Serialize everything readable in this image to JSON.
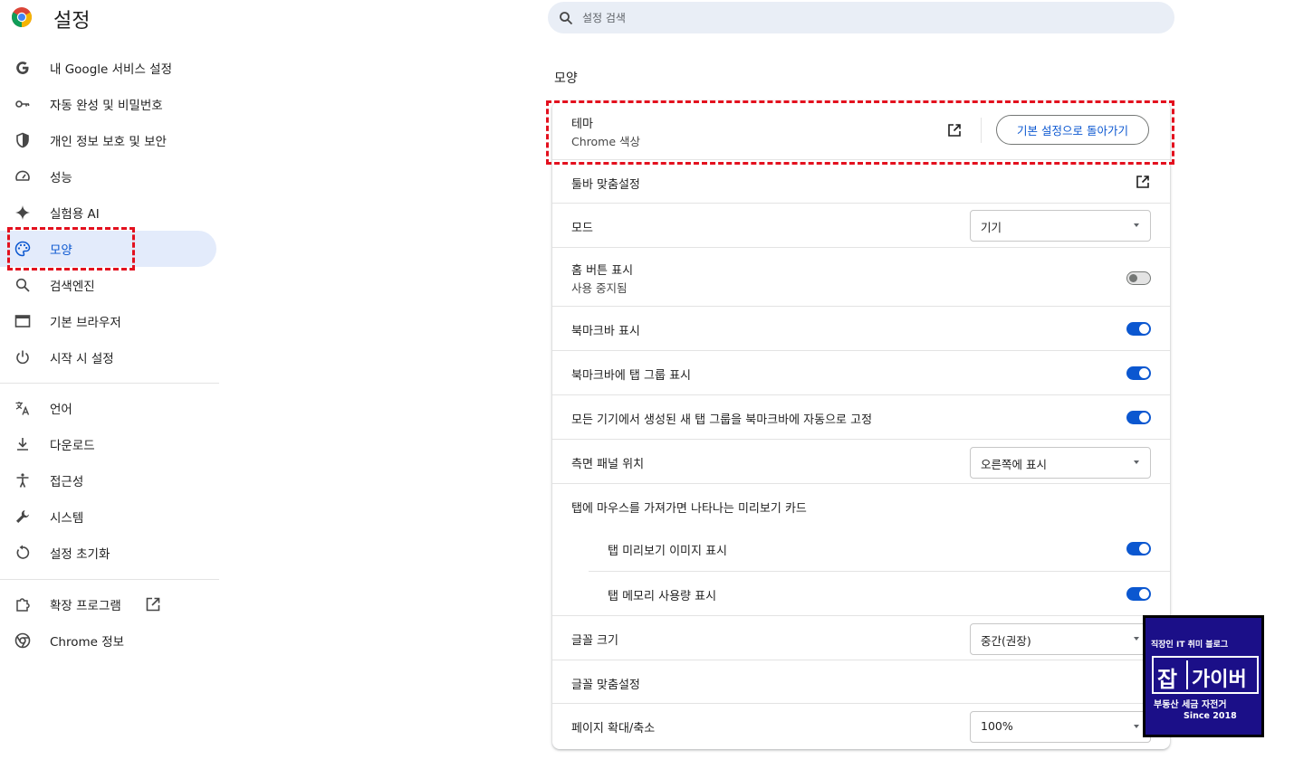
{
  "app": {
    "title": "설정"
  },
  "search": {
    "placeholder": "설정 검색"
  },
  "sidebar": {
    "items": [
      {
        "label": "내 Google 서비스 설정",
        "icon": "google-g-icon"
      },
      {
        "label": "자동 완성 및 비밀번호",
        "icon": "key-icon"
      },
      {
        "label": "개인 정보 보호 및 보안",
        "icon": "shield-icon"
      },
      {
        "label": "성능",
        "icon": "speedometer-icon"
      },
      {
        "label": "실험용 AI",
        "icon": "sparkle-icon"
      },
      {
        "label": "모양",
        "icon": "palette-icon",
        "active": true
      },
      {
        "label": "검색엔진",
        "icon": "search-icon"
      },
      {
        "label": "기본 브라우저",
        "icon": "browser-window-icon"
      },
      {
        "label": "시작 시 설정",
        "icon": "power-icon"
      },
      {
        "label": "언어",
        "icon": "translate-icon"
      },
      {
        "label": "다운로드",
        "icon": "download-icon"
      },
      {
        "label": "접근성",
        "icon": "accessibility-icon"
      },
      {
        "label": "시스템",
        "icon": "wrench-icon"
      },
      {
        "label": "설정 초기화",
        "icon": "reset-icon"
      },
      {
        "label": "확장 프로그램",
        "icon": "puzzle-icon"
      },
      {
        "label": "Chrome 정보",
        "icon": "chrome-icon"
      }
    ]
  },
  "main": {
    "section_title": "모양",
    "theme": {
      "title": "테마",
      "subtitle": "Chrome 색상",
      "reset_label": "기본 설정으로 돌아가기"
    },
    "toolbar": {
      "title": "툴바 맞춤설정"
    },
    "mode": {
      "title": "모드",
      "value": "기기"
    },
    "home_button": {
      "title": "홈 버튼 표시",
      "subtitle": "사용 중지됨",
      "enabled": false
    },
    "bookmarks_bar": {
      "title": "북마크바 표시",
      "enabled": true
    },
    "tab_groups_bar": {
      "title": "북마크바에 탭 그룹 표시",
      "enabled": true
    },
    "auto_pin": {
      "title": "모든 기기에서 생성된 새 탭 그룹을 북마크바에 자동으로 고정",
      "enabled": true
    },
    "side_panel": {
      "title": "측면 패널 위치",
      "value": "오른쪽에 표시"
    },
    "hover_card": {
      "title": "탭에 마우스를 가져가면 나타나는 미리보기 카드"
    },
    "tab_preview": {
      "title": "탭 미리보기 이미지 표시",
      "enabled": true
    },
    "tab_memory": {
      "title": "탭 메모리 사용량 표시",
      "enabled": true
    },
    "font_size": {
      "title": "글꼴 크기",
      "value": "중간(권장)"
    },
    "font_custom": {
      "title": "글꼴 맞춤설정"
    },
    "zoom": {
      "title": "페이지 확대/축소",
      "value": "100%"
    }
  },
  "badge": {
    "line1": "직장인 IT 취미 블로그",
    "big1": "잡",
    "big2": "가이버",
    "line3": "부동산 세금 자전거",
    "line4": "Since 2018"
  },
  "colors": {
    "accent": "#0b57d0",
    "active_bg": "#e3ebfb",
    "highlight": "#e3101e",
    "badge_bg": "#1b0f88"
  }
}
